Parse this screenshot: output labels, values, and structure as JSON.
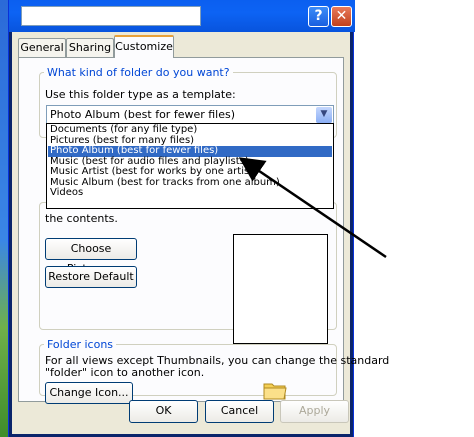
{
  "dialog": {
    "title_field": "",
    "help_glyph": "?",
    "close_glyph": "✕"
  },
  "tabs": [
    {
      "label": "General"
    },
    {
      "label": "Sharing"
    },
    {
      "label": "Customize"
    }
  ],
  "folder_type": {
    "heading": "What kind of folder do you want?",
    "template_label": "Use this folder type as a template:",
    "selected": "Photo Album (best for fewer files)",
    "options": [
      "Documents (for any file type)",
      "Pictures (best for many files)",
      "Photo Album (best for fewer files)",
      "Music (best for audio files and playlists)",
      "Music Artist (best for works by one artist)",
      "Music Album (best for tracks from one album)",
      "Videos"
    ],
    "highlighted_index": 2
  },
  "folder_pictures": {
    "partial_text": "the contents.",
    "choose_button": "Choose Picture...",
    "restore_button": "Restore Default"
  },
  "folder_icons": {
    "heading": "Folder icons",
    "description_line1": "For all views except Thumbnails, you can change the standard",
    "description_line2": "\"folder\" icon to another icon.",
    "change_button": "Change Icon..."
  },
  "footer": {
    "ok": "OK",
    "cancel": "Cancel",
    "apply": "Apply"
  },
  "icons": {
    "help": "help-icon",
    "close": "close-icon",
    "dropdown": "chevron-down-icon",
    "folder": "folder-icon"
  },
  "colors": {
    "titlebar": "#0b5ff0",
    "selection": "#316ac5",
    "group_title": "#0046d5",
    "tab_accent": "#e8a13a",
    "dialog_face": "#ece9d8"
  }
}
